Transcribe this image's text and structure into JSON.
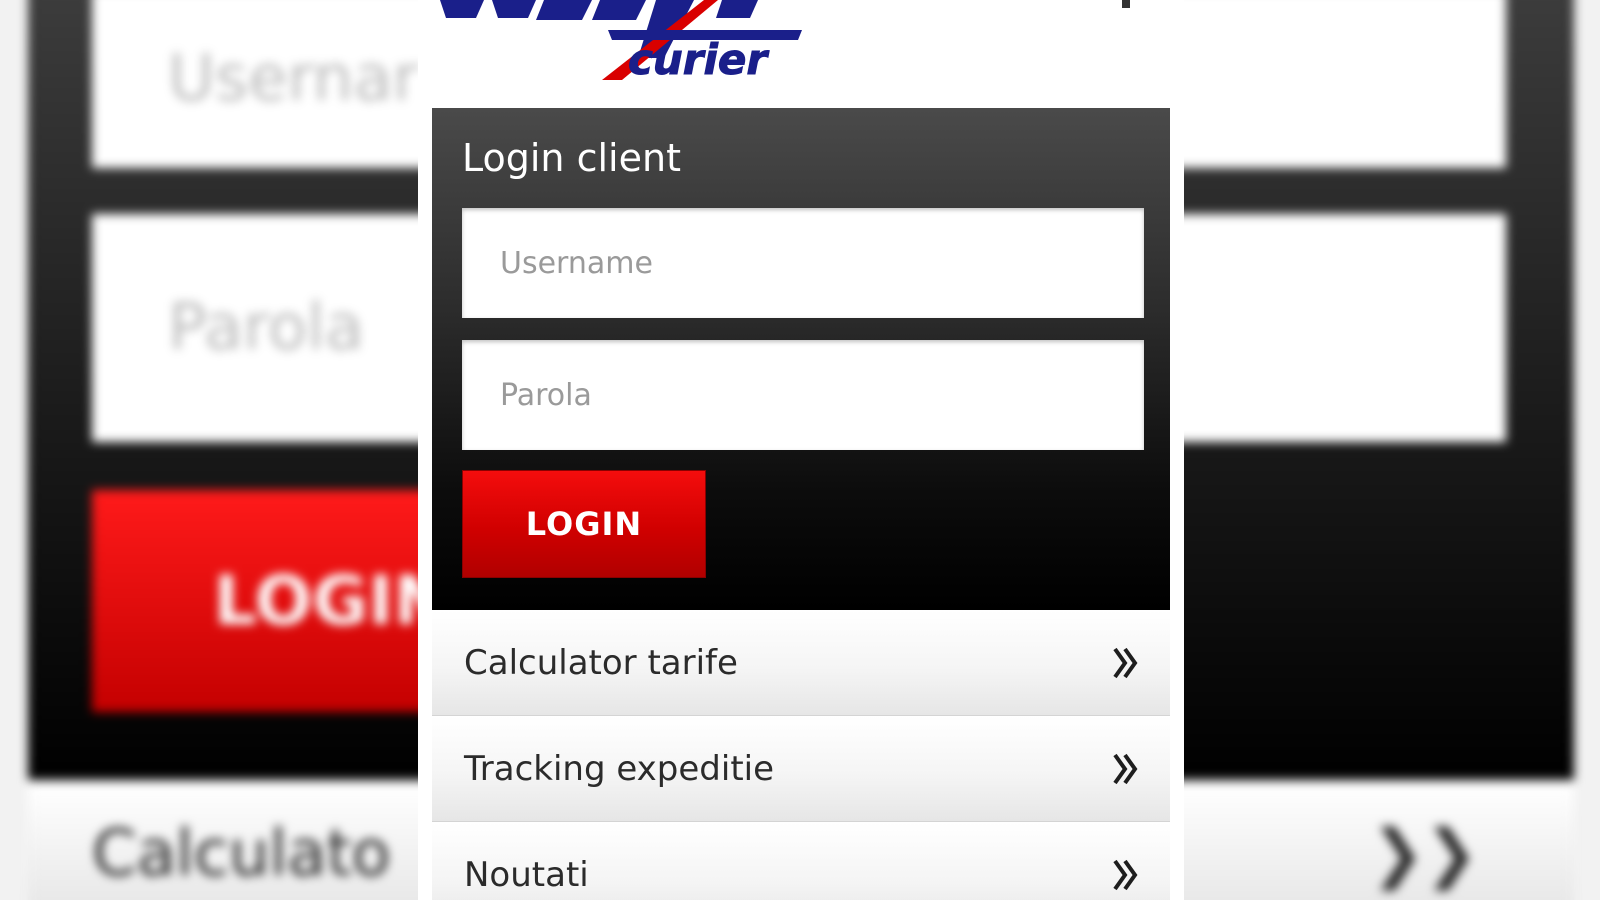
{
  "login": {
    "title": "Login client",
    "username_placeholder": "Username",
    "password_placeholder": "Parola",
    "button_label": "LOGIN"
  },
  "menu": {
    "items": [
      {
        "label": "Calculator tarife",
        "icon": "double-chevron-right-icon"
      },
      {
        "label": "Tracking expeditie",
        "icon": "double-chevron-right-icon"
      },
      {
        "label": "Noutati",
        "icon": "double-chevron-right-icon"
      }
    ]
  },
  "background": {
    "username_placeholder": "Usernar",
    "password_placeholder": "Parola",
    "button_label": "LOGIN",
    "menu_label": "Calculato"
  },
  "colors": {
    "brand_blue": "#1a1f8a",
    "brand_red": "#d90000",
    "panel_dark": "#2c2c2c",
    "button_red": "#e00000"
  }
}
